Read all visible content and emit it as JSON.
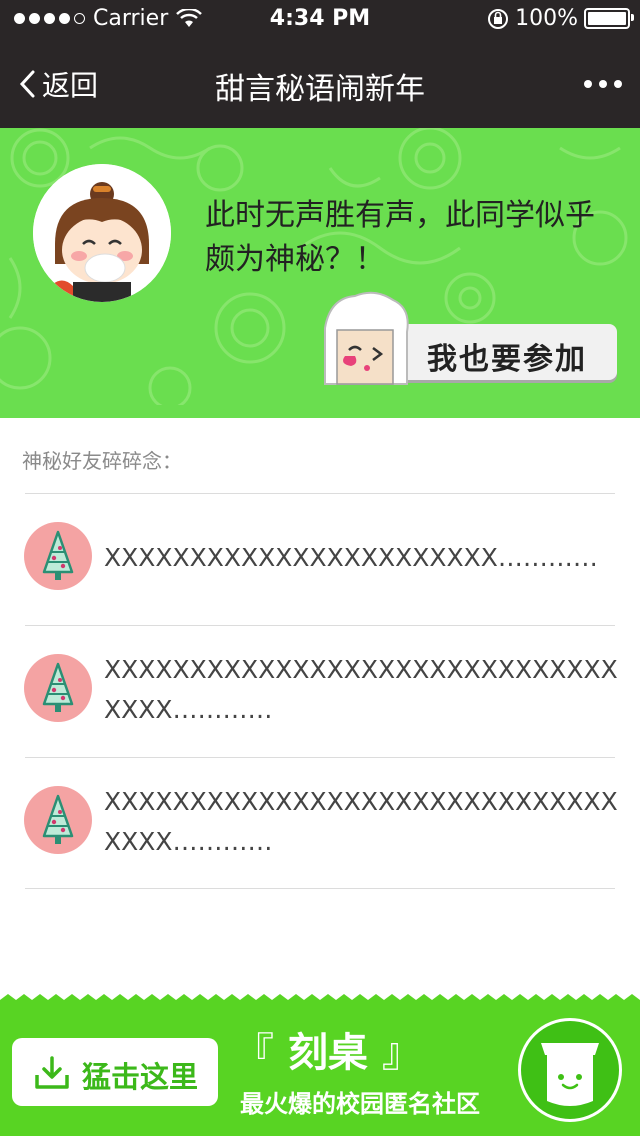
{
  "status": {
    "carrier": "Carrier",
    "time": "4:34 PM",
    "battery": "100%",
    "signal_dots_filled": 4,
    "signal_dots_total": 5
  },
  "nav": {
    "back_label": "返回",
    "title": "甜言秘语闹新年"
  },
  "hero": {
    "message": "此时无声胜有声，此同学似乎颇为神秘？！",
    "join_label": "我也要参加",
    "accent_color": "#6ade4f"
  },
  "section": {
    "label": "神秘好友碎碎念："
  },
  "messages": [
    {
      "text": "XXXXXXXXXXXXXXXXXXXXXXX…………"
    },
    {
      "text": "XXXXXXXXXXXXXXXXXXXXXXXXXXXXXXXXXX…………"
    },
    {
      "text": "XXXXXXXXXXXXXXXXXXXXXXXXXXXXXXXXXX…………"
    }
  ],
  "footer": {
    "download_label": "猛击这里",
    "brand_open": "『",
    "brand_name": "刻桌",
    "brand_close": "』",
    "slogan": "最火爆的校园匿名社区",
    "accent_color": "#58d423"
  },
  "icons": {
    "back": "chevron-left-icon",
    "more": "more-dots-icon",
    "wifi": "wifi-icon",
    "lock": "orientation-lock-icon",
    "battery": "battery-icon",
    "tree": "christmas-tree-icon",
    "download": "download-icon"
  }
}
